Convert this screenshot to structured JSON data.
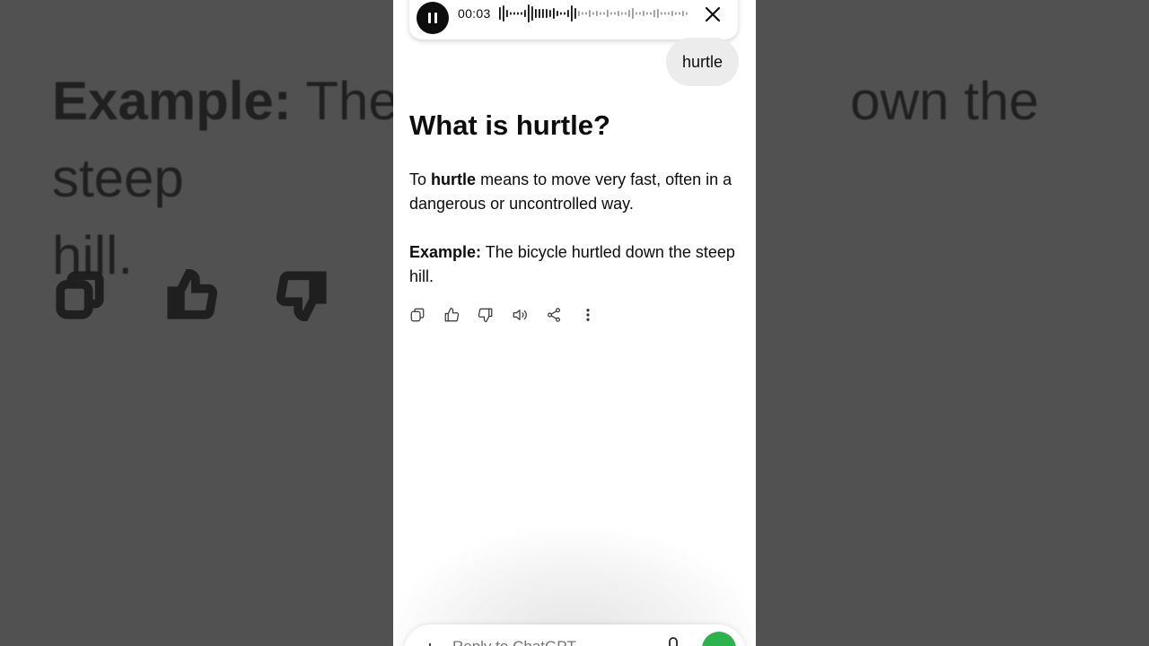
{
  "background": {
    "example_label": "Example:",
    "example_text_left": "The b",
    "example_text_right": "own the steep",
    "example_text_line2": "hill."
  },
  "audio": {
    "elapsed": "00:03",
    "pause_icon": "pause-icon",
    "close_icon": "close-icon"
  },
  "user_message": "hurtle",
  "response": {
    "heading": "What is hurtle?",
    "def_prefix": "To",
    "def_term": "hurtle",
    "def_rest": "means to move very fast, often in a dangerous or uncontrolled way.",
    "example_label": "Example:",
    "example_text": "The bicycle hurtled down the steep hill."
  },
  "actions": [
    "copy-icon",
    "thumbs-up-icon",
    "thumbs-down-icon",
    "read-aloud-icon",
    "share-icon",
    "more-icon"
  ],
  "composer": {
    "plus": "+",
    "placeholder": "Reply to ChatGPT"
  },
  "colors": {
    "accent": "#2bb44b",
    "bubble": "#ececec",
    "overlay": "#515151"
  }
}
